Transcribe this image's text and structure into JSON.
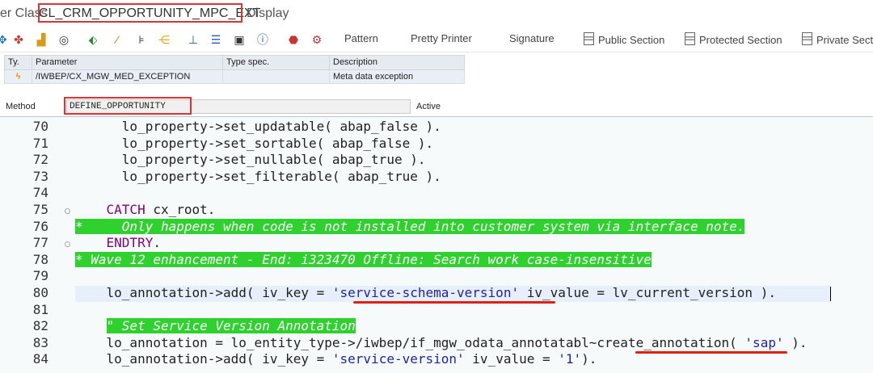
{
  "title": {
    "prefix": "er Class",
    "class_name": "CL_CRM_OPPORTUNITY_MPC_EXT",
    "mode": "Display"
  },
  "toolbar": {
    "icons": [
      "settings-tree-icon",
      "briefcase-icon",
      "target-icon",
      "hierarchy-icon",
      "magic-wand-icon",
      "where-used-icon",
      "structure-icon",
      "org-chart-icon",
      "list-icon",
      "frame-icon",
      "info-icon",
      "stop-icon",
      "debug-icon"
    ],
    "pattern": "Pattern",
    "pretty_printer": "Pretty Printer",
    "signature": "Signature",
    "public_section": "Public Section",
    "protected_section": "Protected Section",
    "private_section": "Private Sect"
  },
  "params": {
    "headers": [
      "Ty.",
      "Parameter",
      "Type spec.",
      "Description"
    ],
    "rows": [
      {
        "type": "ϟ",
        "parameter": "/IWBEP/CX_MGW_MED_EXCEPTION",
        "type_spec": "",
        "description": "Meta data exception"
      }
    ]
  },
  "method": {
    "label": "Method",
    "name": "DEFINE_OPPORTUNITY",
    "status": "Active"
  },
  "code": {
    "lines": [
      {
        "n": "70",
        "parts": [
          {
            "t": "      lo_property->set_updatable( abap_false )."
          }
        ]
      },
      {
        "n": "71",
        "parts": [
          {
            "t": "      lo_property->set_sortable( abap_false )."
          }
        ]
      },
      {
        "n": "72",
        "parts": [
          {
            "t": "      lo_property->set_nullable( abap_true )."
          }
        ]
      },
      {
        "n": "73",
        "parts": [
          {
            "t": "      lo_property->set_filterable( abap_true )."
          }
        ]
      },
      {
        "n": "74",
        "parts": [
          {
            "t": ""
          }
        ]
      },
      {
        "n": "75",
        "parts": [
          {
            "t": "    ",
            "c": ""
          },
          {
            "t": "CATCH",
            "c": "kw"
          },
          {
            "t": " cx_root."
          }
        ]
      },
      {
        "n": "76",
        "parts": [
          {
            "t": "*     Only happens when code is not installed into customer system via interface note.",
            "c": "cmt"
          }
        ]
      },
      {
        "n": "77",
        "parts": [
          {
            "t": "    ",
            "c": ""
          },
          {
            "t": "ENDTRY",
            "c": "kw"
          },
          {
            "t": "."
          }
        ]
      },
      {
        "n": "78",
        "parts": [
          {
            "t": "* Wave 12 enhancement - End: i323470 Offline: Search work case-insensitive",
            "c": "cmt"
          }
        ]
      },
      {
        "n": "79",
        "parts": [
          {
            "t": ""
          }
        ]
      },
      {
        "n": "80",
        "parts": [
          {
            "t": "    lo_annotation->add( iv_key = "
          },
          {
            "t": "'service-schema-version'",
            "c": "str"
          },
          {
            "t": " iv_value = lv_current_version )."
          }
        ]
      },
      {
        "n": "81",
        "parts": [
          {
            "t": ""
          }
        ]
      },
      {
        "n": "82",
        "parts": [
          {
            "t": "    ",
            "c": ""
          },
          {
            "t": "\" Set Service Version Annotation",
            "c": "cmt"
          }
        ]
      },
      {
        "n": "83",
        "parts": [
          {
            "t": "    lo_annotation = lo_entity_type->/iwbep/if_mgw_odata_annotatabl~create_annotation( "
          },
          {
            "t": "'sap'",
            "c": "str"
          },
          {
            "t": " )."
          }
        ]
      },
      {
        "n": "84",
        "parts": [
          {
            "t": "    lo_annotation->add( iv_key = "
          },
          {
            "t": "'service-version'",
            "c": "str"
          },
          {
            "t": " iv_value = "
          },
          {
            "t": "'1'",
            "c": "str"
          },
          {
            "t": ")."
          }
        ]
      }
    ]
  }
}
